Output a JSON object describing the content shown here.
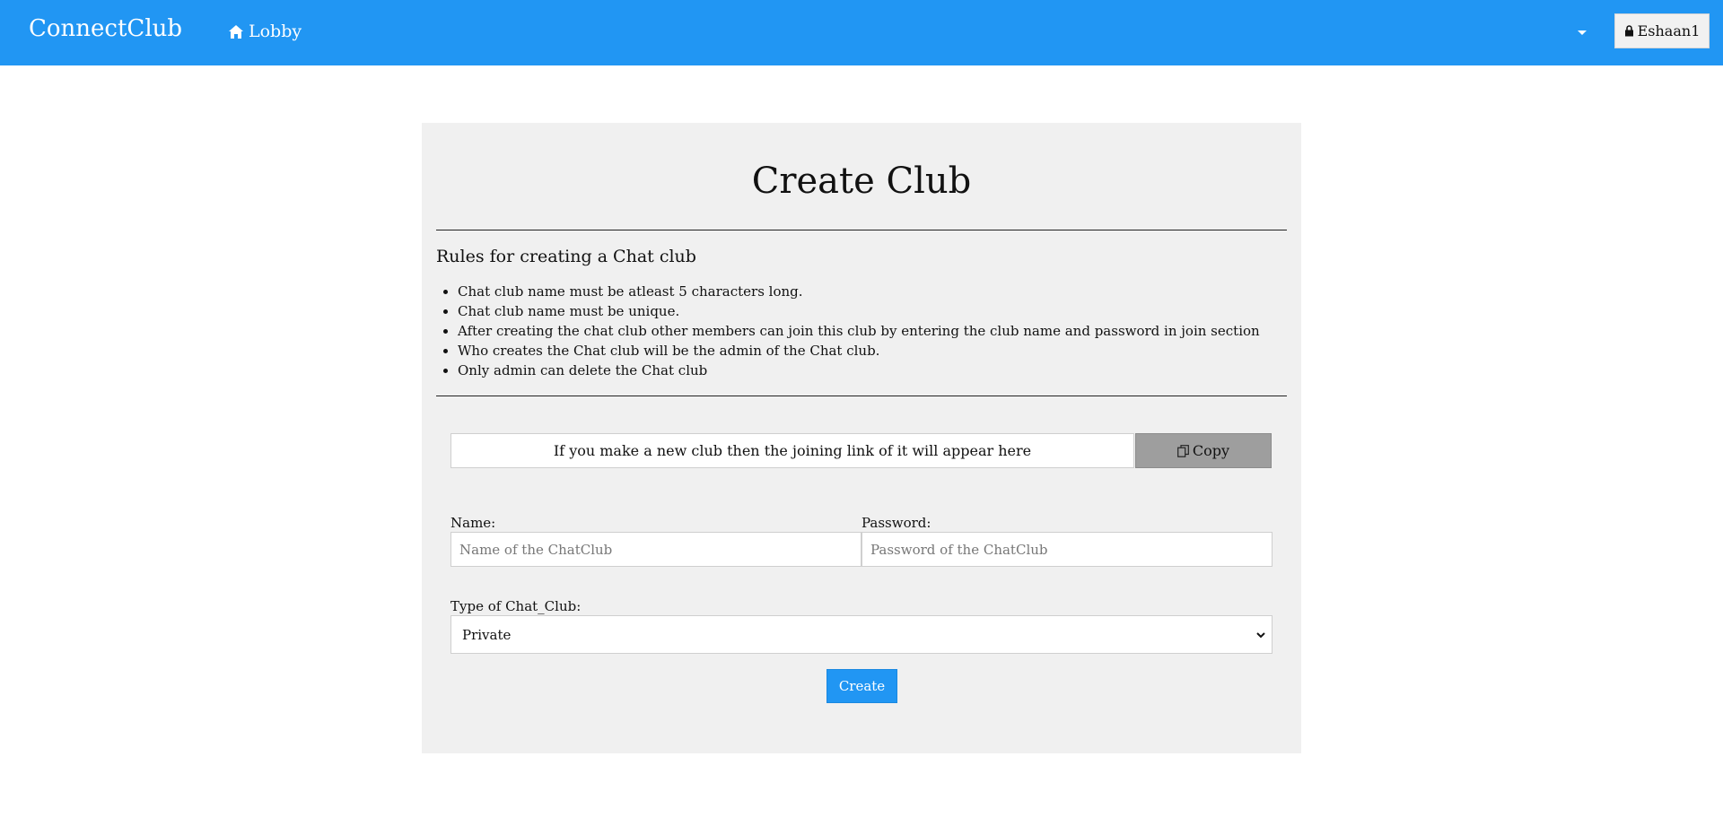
{
  "header": {
    "brand": "ConnectClub",
    "nav_lobby": "Lobby",
    "user_button": "Eshaan1"
  },
  "panel": {
    "title": "Create Club",
    "rules_heading": "Rules for creating a Chat club",
    "rules": [
      "Chat club name must be atleast 5 characters long.",
      "Chat club name must be unique.",
      "After creating the chat club other members can join this club by entering the club name and password in join section",
      "Who creates the Chat club will be the admin of the Chat club.",
      "Only admin can delete the Chat club"
    ],
    "link_placeholder": "If you make a new club then the joining link of it will appear here",
    "copy_label": "Copy",
    "name_label": "Name:",
    "name_placeholder": "Name of the ChatClub",
    "password_label": "Password:",
    "password_placeholder": "Password of the ChatClub",
    "type_label": "Type of Chat_Club:",
    "type_selected": "Private",
    "create_label": "Create"
  },
  "colors": {
    "accent": "#2196f3",
    "panel_bg": "#f0f0f0",
    "copy_bg": "#9e9e9e"
  },
  "icons": [
    "home-icon",
    "caret-down-icon",
    "lock-icon",
    "copy-icon",
    "select-chevron-icon"
  ]
}
